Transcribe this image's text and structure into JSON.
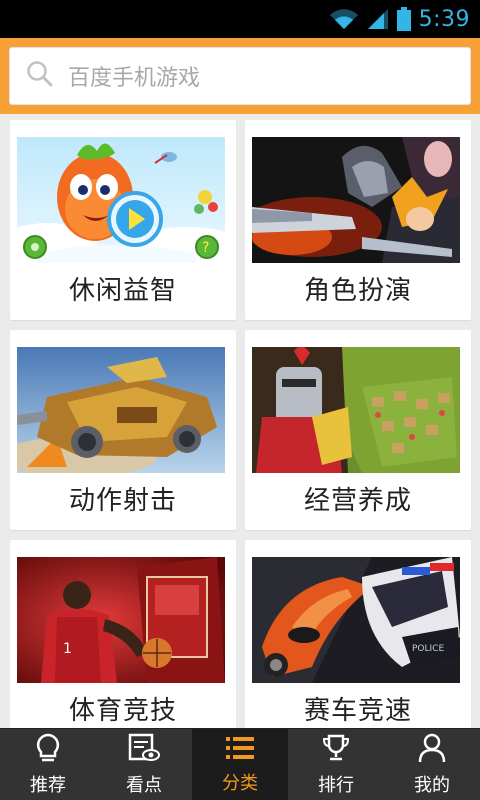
{
  "status_bar": {
    "time": "5:39",
    "accent": "#33b5e5"
  },
  "search": {
    "placeholder": "百度手机游戏"
  },
  "categories": [
    {
      "label": "休闲益智"
    },
    {
      "label": "角色扮演"
    },
    {
      "label": "动作射击"
    },
    {
      "label": "经营养成"
    },
    {
      "label": "体育竞技"
    },
    {
      "label": "赛车竞速"
    }
  ],
  "tabs": [
    {
      "label": "推荐",
      "icon": "lightbulb-icon",
      "active": false
    },
    {
      "label": "看点",
      "icon": "news-eye-icon",
      "active": false
    },
    {
      "label": "分类",
      "icon": "list-icon",
      "active": true
    },
    {
      "label": "排行",
      "icon": "trophy-icon",
      "active": false
    },
    {
      "label": "我的",
      "icon": "person-icon",
      "active": false
    }
  ],
  "colors": {
    "header": "#f7a035",
    "active_tab": "#f39a1e",
    "tab_bar": "#333333"
  }
}
